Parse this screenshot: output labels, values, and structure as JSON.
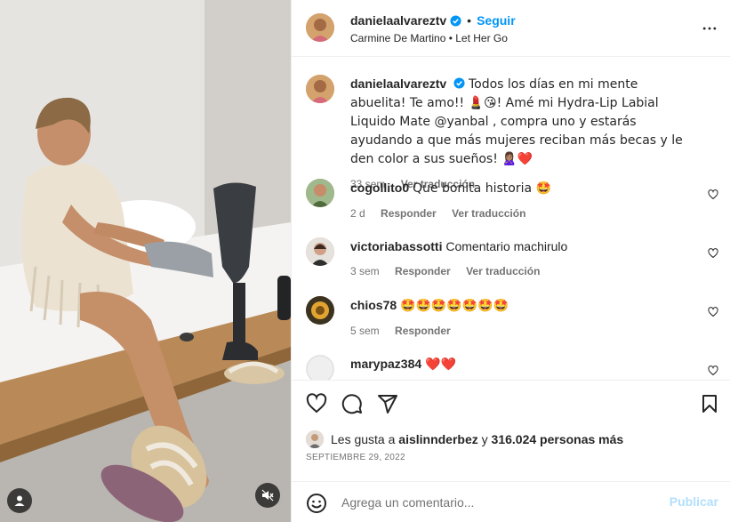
{
  "post": {
    "username": "danielaalvareztv",
    "follow_label": "Seguir",
    "separator": "•",
    "audio": "Carmine De Martino • Let Her Go"
  },
  "caption": {
    "username": "danielaalvareztv",
    "text": "Todos los días en mi mente abuelita! Te amo!! 💄😘! Amé mi Hydra-Lip Labial Liquido Mate @yanbal , compra uno y estarás ayudando a que más mujeres reciban más becas y le den color a sus sueños! 🙎🏽‍♀️❤️",
    "time": "33 sem",
    "translate_label": "Ver traducción"
  },
  "comments": [
    {
      "username": "cogollito0",
      "text": "Que bonita historia 🤩",
      "time": "2 d",
      "reply_label": "Responder",
      "translate_label": "Ver traducción"
    },
    {
      "username": "victoriabassotti",
      "text": "Comentario machirulo",
      "time": "3 sem",
      "reply_label": "Responder",
      "translate_label": "Ver traducción"
    },
    {
      "username": "chios78",
      "text": "🤩🤩🤩🤩🤩🤩🤩",
      "time": "5 sem",
      "reply_label": "Responder"
    },
    {
      "username": "marypaz384",
      "text": "❤️❤️"
    }
  ],
  "likes": {
    "prefix": "Les gusta a",
    "user": "aislinnderbez",
    "middle": "y",
    "count": "316.024 personas más"
  },
  "date": "SEPTIEMBRE 29, 2022",
  "add_comment": {
    "placeholder": "Agrega un comentario...",
    "publish_label": "Publicar"
  },
  "icons": {
    "verified": "verified-badge-icon",
    "more": "more-options-icon",
    "like": "heart-icon",
    "comment": "comment-icon",
    "share": "share-icon",
    "save": "bookmark-icon",
    "emoji": "smiley-icon",
    "mute": "muted-speaker-icon",
    "tagged_user": "user-icon"
  },
  "colors": {
    "accent": "#0095f6",
    "verified": "#0095f6",
    "publish_disabled": "#b2dffc",
    "secondary_text": "#737373"
  }
}
